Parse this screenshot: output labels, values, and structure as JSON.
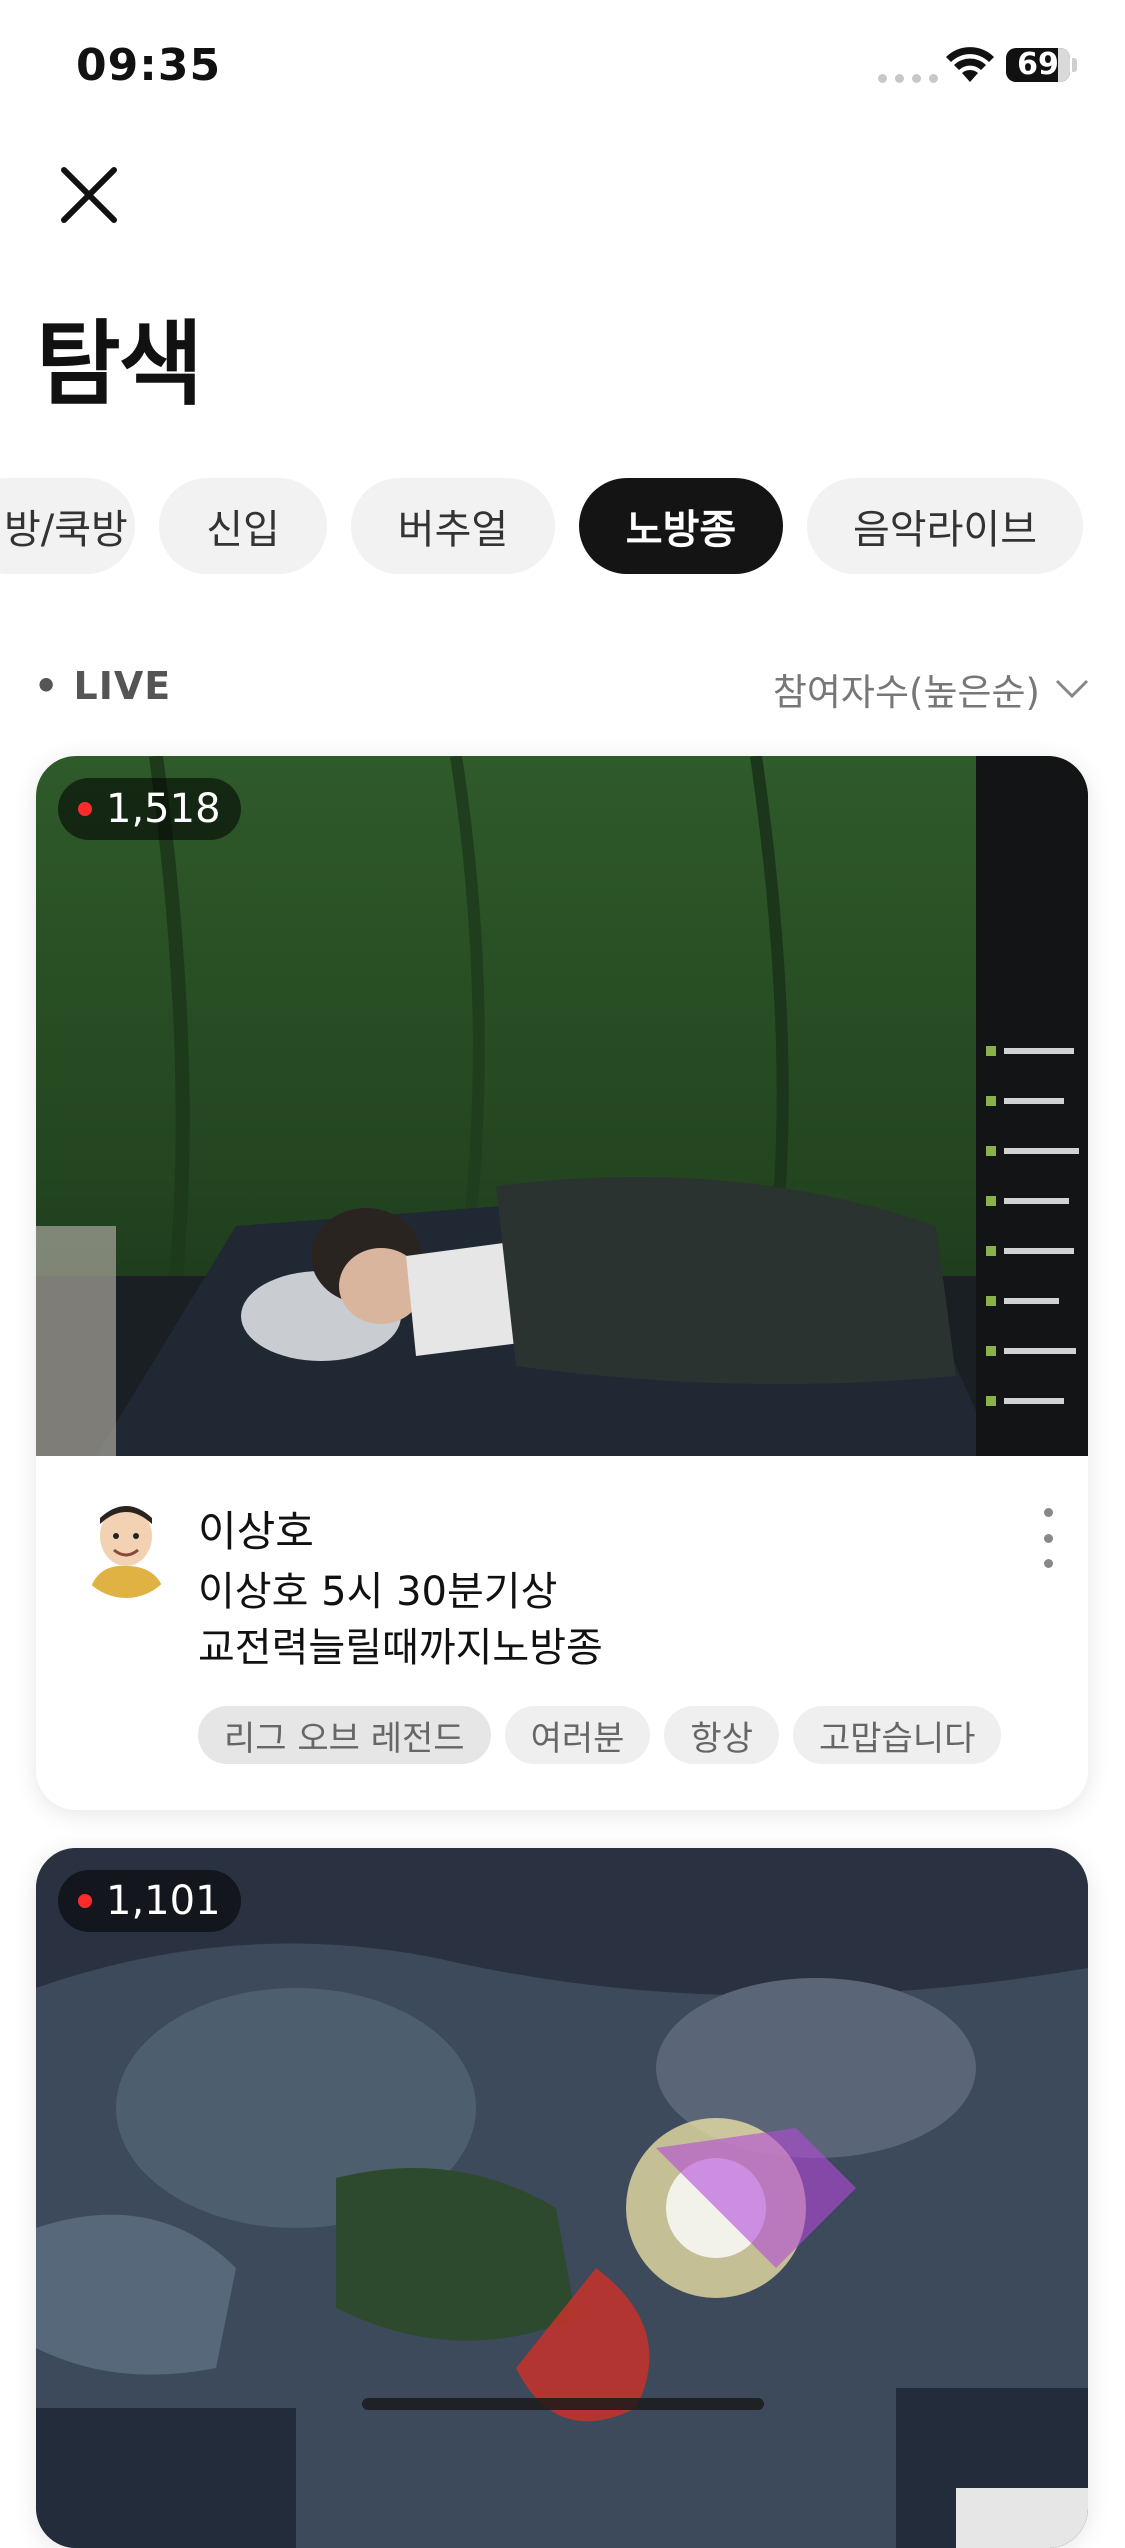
{
  "status_bar": {
    "time": "09:35",
    "battery": "69"
  },
  "header": {
    "title": "탐색"
  },
  "categories": [
    {
      "label": "먹방/쿡방",
      "active": false
    },
    {
      "label": "신입",
      "active": false
    },
    {
      "label": "버추얼",
      "active": false
    },
    {
      "label": "노방종",
      "active": true
    },
    {
      "label": "음악라이브",
      "active": false
    }
  ],
  "section": {
    "live_label": "• LIVE",
    "sort_label": "참여자수(높은순)"
  },
  "streams": [
    {
      "viewers": "1,518",
      "streamer": "이상호",
      "title_line1": "이상호 5시 30분기상",
      "title_line2": "교전력늘릴때까지노방종",
      "tags": [
        "리그 오브 레전드",
        "여러분",
        "항상",
        "고맙습니다"
      ]
    },
    {
      "viewers": "1,101"
    }
  ],
  "colors": {
    "accent": "#141414",
    "live_dot": "#ff2a2a",
    "chip_bg": "#f2f2f2"
  },
  "icons": {
    "close": "close-icon",
    "sort": "chevron-down-icon",
    "more": "more-vertical-icon"
  }
}
